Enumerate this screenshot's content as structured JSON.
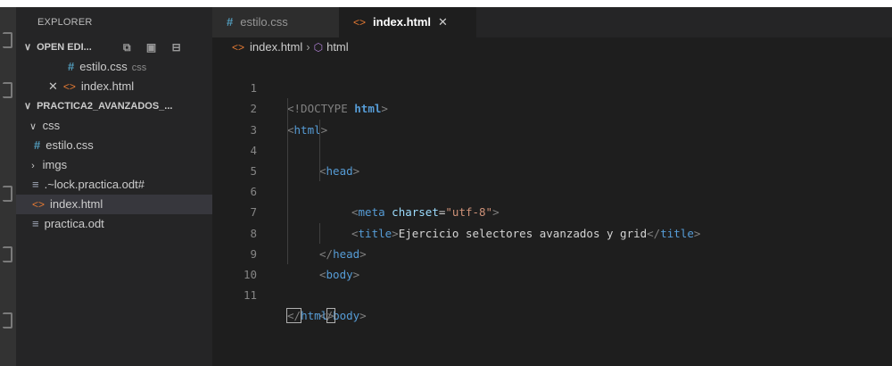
{
  "sidebar": {
    "title": "EXPLORER",
    "open_editors": {
      "label": "OPEN EDI...",
      "items": [
        {
          "name": "estilo.css",
          "hint": "css"
        },
        {
          "name": "index.html"
        }
      ]
    },
    "project": {
      "label": "PRACTICA2_AVANZADOS_...",
      "tree": [
        {
          "name": "css",
          "kind": "folder-open"
        },
        {
          "name": "estilo.css",
          "kind": "css"
        },
        {
          "name": "imgs",
          "kind": "folder-closed"
        },
        {
          "name": ".~lock.practica.odt#",
          "kind": "file"
        },
        {
          "name": "index.html",
          "kind": "html"
        },
        {
          "name": "practica.odt",
          "kind": "file"
        }
      ]
    }
  },
  "tabs": [
    {
      "label": "estilo.css",
      "active": false
    },
    {
      "label": "index.html",
      "active": true
    }
  ],
  "breadcrumb": {
    "file": "index.html",
    "symbol": "html"
  },
  "code": {
    "line_numbers": [
      "1",
      "2",
      "3",
      "4",
      "5",
      "6",
      "7",
      "8",
      "9",
      "10",
      "11"
    ],
    "l1": {
      "open": "<!DOCTYPE",
      "word": "html",
      "close": ">"
    },
    "l2": {
      "open": "<",
      "tag": "html",
      "close": ">"
    },
    "l3": {
      "open": "<",
      "tag": "head",
      "close": ">"
    },
    "l4": {
      "open": "<",
      "tag": "meta",
      "attr": "charset",
      "eq": "=",
      "val": "\"utf-8\"",
      "close": ">"
    },
    "l5": {
      "open": "<",
      "tag": "title",
      "close": ">",
      "text": "Ejercicio selectores avanzados y grid",
      "open2": "</",
      "tag2": "title",
      "close2": ">"
    },
    "l7": {
      "open": "</",
      "tag": "head",
      "close": ">"
    },
    "l8": {
      "open": "<",
      "tag": "body",
      "close": ">"
    },
    "l10": {
      "open": "</",
      "tag": "body",
      "close": ">"
    },
    "l11": {
      "open": "</",
      "tag": "html",
      "close": ">"
    }
  },
  "colors": {
    "background": "#1e1e1e",
    "sidebar": "#252526",
    "tag": "#569cd6",
    "attribute": "#9cdcfe",
    "string": "#ce9178",
    "css_icon": "#519aba",
    "html_icon": "#e37933"
  }
}
